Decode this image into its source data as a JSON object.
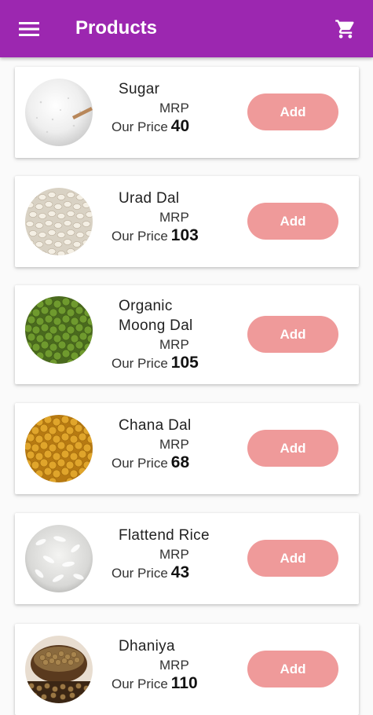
{
  "appbar": {
    "title": "Products",
    "menu_icon": "menu-icon",
    "cart_icon": "shopping-cart-icon",
    "color": "#9c27b0"
  },
  "products": [
    {
      "name": "Sugar",
      "mrp_label": "MRP",
      "price_label": "Our Price",
      "price": "40",
      "add_label": "Add",
      "image": "sugar-image"
    },
    {
      "name": "Urad Dal",
      "mrp_label": "MRP",
      "price_label": "Our Price",
      "price": "103",
      "add_label": "Add",
      "image": "urad-dal-image"
    },
    {
      "name": "Organic Moong Dal",
      "mrp_label": "MRP",
      "price_label": "Our Price",
      "price": "105",
      "add_label": "Add",
      "image": "moong-dal-image"
    },
    {
      "name": "Chana Dal",
      "mrp_label": "MRP",
      "price_label": "Our Price",
      "price": "68",
      "add_label": "Add",
      "image": "chana-dal-image"
    },
    {
      "name": "Flattend Rice",
      "mrp_label": "MRP",
      "price_label": "Our Price",
      "price": "43",
      "add_label": "Add",
      "image": "flattened-rice-image"
    },
    {
      "name": "Dhaniya",
      "mrp_label": "MRP",
      "price_label": "Our Price",
      "price": "110",
      "add_label": "Add",
      "image": "dhaniya-image"
    }
  ],
  "colors": {
    "add_button": "#ef9a9a",
    "background": "#fafafa"
  }
}
